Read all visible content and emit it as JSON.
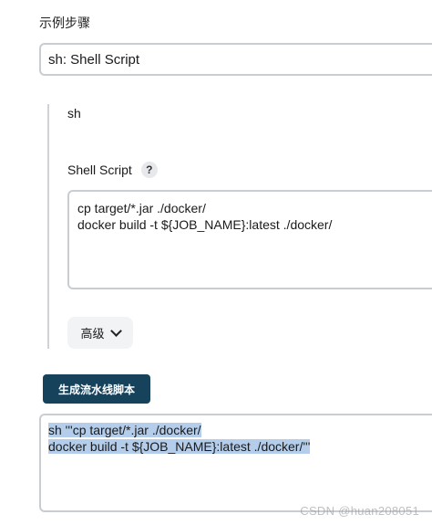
{
  "section_label": "示例步骤",
  "step_select": {
    "value": "sh: Shell Script"
  },
  "step": {
    "name": "sh",
    "script_label": "Shell Script",
    "help_icon": "?",
    "script_lines": [
      "cp target/*.jar ./docker/",
      "docker build -t ${JOB_NAME}:latest ./docker/"
    ],
    "advanced_label": "高级"
  },
  "generate_button": "生成流水线脚本",
  "output": {
    "lines": [
      "sh '''cp target/*.jar ./docker/",
      "docker build -t ${JOB_NAME}:latest ./docker/'''"
    ],
    "selected": true
  },
  "watermark": "CSDN @huan208051",
  "colors": {
    "primary_button": "#16425b",
    "selection": "#b4cdea",
    "border": "#c9cdd2"
  }
}
